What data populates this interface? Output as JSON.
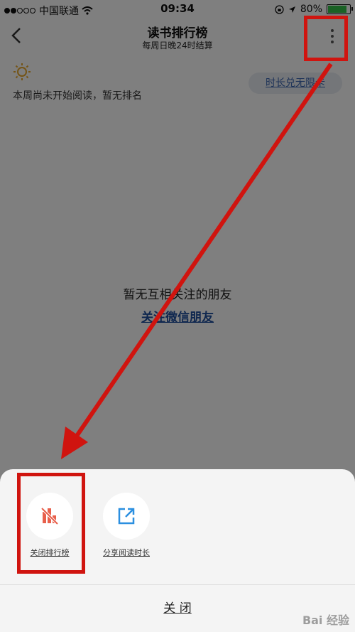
{
  "status_bar": {
    "carrier": "中国联通",
    "time": "09:34",
    "battery": "80%",
    "battery_level": 0.8
  },
  "header": {
    "title": "读书排行榜",
    "subtitle": "每周日晚24时结算"
  },
  "notice": {
    "text": "本周尚未开始阅读，暂无排名",
    "redeem_label": "时长兑无限卡"
  },
  "empty_state": {
    "text": "暂无互相关注的朋友",
    "link": "关注微信朋友"
  },
  "sheet": {
    "actions": [
      {
        "label": "关闭排行榜",
        "icon": "ranking-off-icon"
      },
      {
        "label": "分享阅读时长",
        "icon": "share-icon"
      }
    ],
    "close_label": "关 闭"
  },
  "colors": {
    "annotation_red": "#d0140f",
    "link_blue": "#1f4e9e",
    "ranking_icon": "#e8604c",
    "share_icon": "#2b8fe0"
  },
  "watermark": "Bai 经验"
}
